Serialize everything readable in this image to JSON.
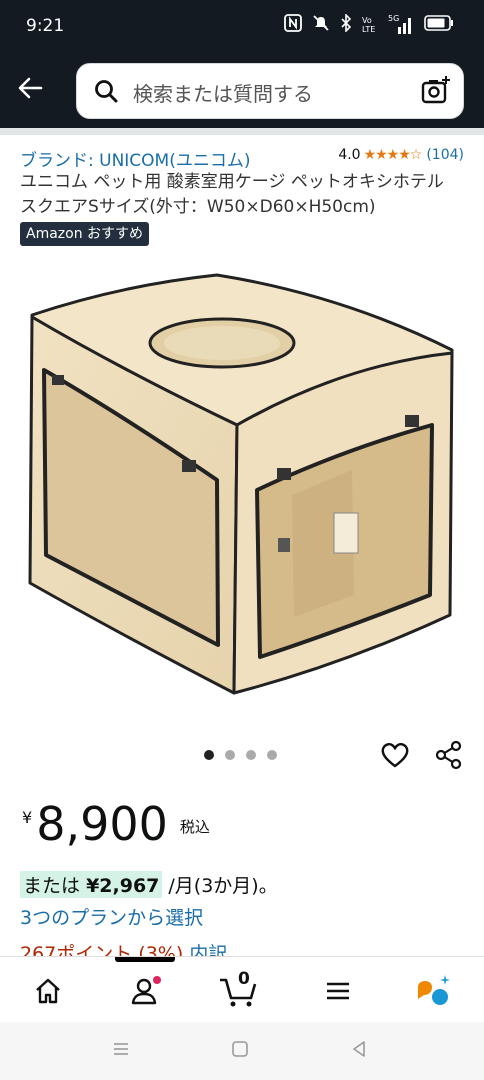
{
  "status_bar": {
    "time": "9:21",
    "icons": [
      "nfc-icon",
      "mute-icon",
      "bluetooth-icon",
      "volte-icon",
      "signal-5g-icon",
      "battery-icon"
    ],
    "volte_label": "Vo LTE",
    "net_label": "5G"
  },
  "header": {
    "search_placeholder": "検索または質問する"
  },
  "product": {
    "brand": "ブランド: UNICOM(ユニコム)",
    "rating": "4.0",
    "stars": "★★★★☆",
    "review_count": "(104)",
    "title": "ユニコム ペット用 酸素室用ケージ ペットオキシホテル スクエアSサイズ(外寸：W50×D60×H50cm)",
    "badge": "Amazon おすすめ",
    "image_dots": 4,
    "active_dot": 0
  },
  "pricing": {
    "currency": "¥",
    "amount": "8,900",
    "tax_label": "税込",
    "installment_prefix": "または",
    "installment_amount": "¥2,967",
    "installment_suffix": "/月(3か月)。",
    "plans_link": "3つのプランから選択",
    "points": "267ポイント (3%)",
    "points_link": "内訳"
  },
  "bottom_nav": {
    "cart_count": "0",
    "items": [
      "home-icon",
      "account-icon",
      "cart-icon",
      "menu-icon",
      "rufus-icon"
    ]
  },
  "colors": {
    "header_bg": "#131a22",
    "link": "#1a6ea8",
    "star": "#e47911",
    "points": "#b12704",
    "installment_highlight": "#d4f3e6"
  }
}
